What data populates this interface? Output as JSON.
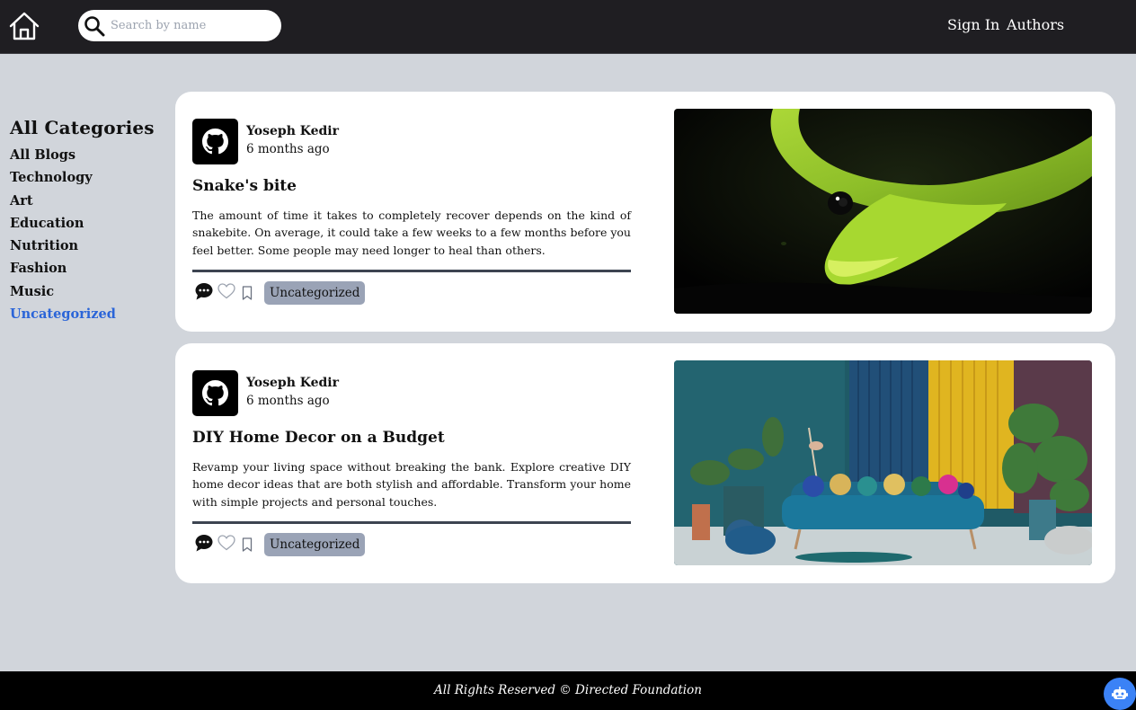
{
  "navbar": {
    "home_icon": "home-icon",
    "search": {
      "icon": "search-icon",
      "placeholder": "Search by name",
      "value": ""
    },
    "sign_in_label": "Sign In",
    "authors_label": "Authors",
    "background": "#1f1e22"
  },
  "sidebar": {
    "title": "All Categories",
    "items": [
      {
        "label": "All Blogs"
      },
      {
        "label": "Technology"
      },
      {
        "label": "Art"
      },
      {
        "label": "Education"
      },
      {
        "label": "Nutrition"
      },
      {
        "label": "Fashion"
      },
      {
        "label": "Music"
      },
      {
        "label": "Uncategorized",
        "active": true
      }
    ],
    "active_color": "#2b65d8"
  },
  "posts": [
    {
      "author": "Yoseph Kedir",
      "time": "6 months ago",
      "avatar_icon": "github-icon",
      "title": "Snake's bite",
      "excerpt": "The amount of time it takes to completely recover depends on the kind of snakebite. On average, it could take a few weeks to a few months before you feel better. Some people may need longer to heal than others.",
      "tag": "Uncategorized",
      "image": "green-snake-photo"
    },
    {
      "author": "Yoseph Kedir",
      "time": "6 months ago",
      "avatar_icon": "github-icon",
      "title": "DIY Home Decor on a Budget",
      "excerpt": "Revamp your living space without breaking the bank. Explore creative DIY home decor ideas that are both stylish and affordable. Transform your home with simple projects and personal touches.",
      "tag": "Uncategorized",
      "image": "living-room-sofa-photo"
    }
  ],
  "footer": {
    "text": "All Rights Reserved © Directed Foundation"
  },
  "chat_button": {
    "icon": "robot-icon",
    "color": "#3b82f6"
  }
}
